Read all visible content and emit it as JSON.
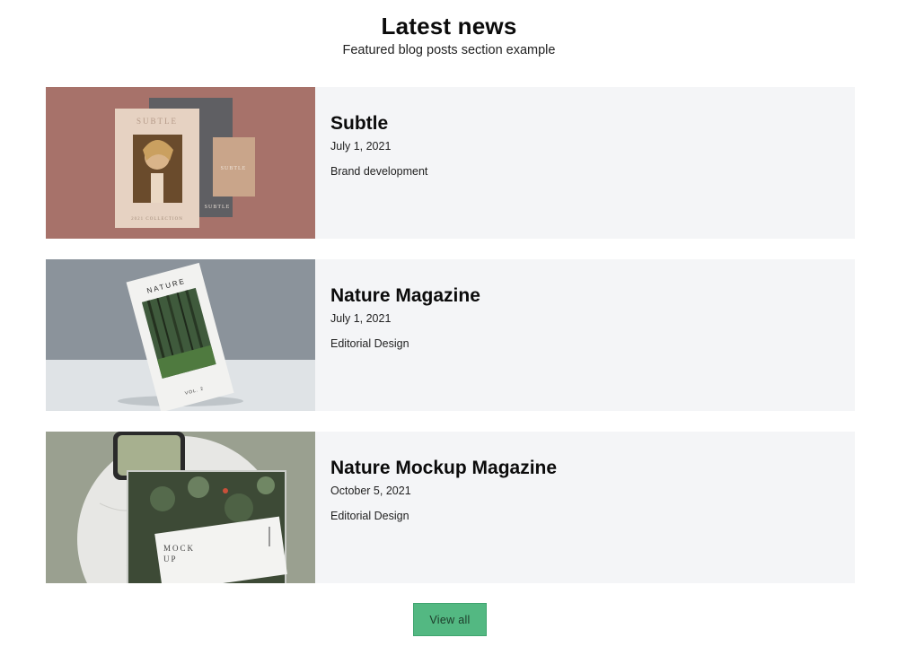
{
  "header": {
    "title": "Latest news",
    "subtitle": "Featured blog posts section example"
  },
  "posts": [
    {
      "title": "Subtle",
      "date": "July 1, 2021",
      "category": "Brand development",
      "image_text": {
        "brand": "SUBTLE",
        "card_brand": "SUBTLE",
        "back_brand": "SUBTLE",
        "collection": "2021 COLLECTION"
      }
    },
    {
      "title": "Nature Magazine",
      "date": "July 1, 2021",
      "category": "Editorial Design",
      "image_text": {
        "brand": "NATURE",
        "volume": "VOL. 2"
      }
    },
    {
      "title": "Nature Mockup Magazine",
      "date": "October 5, 2021",
      "category": "Editorial Design",
      "image_text": {
        "cover_line1": "MOCK",
        "cover_line2": "UP"
      }
    }
  ],
  "footer": {
    "view_all_label": "View all",
    "button_color": "#53b882"
  }
}
